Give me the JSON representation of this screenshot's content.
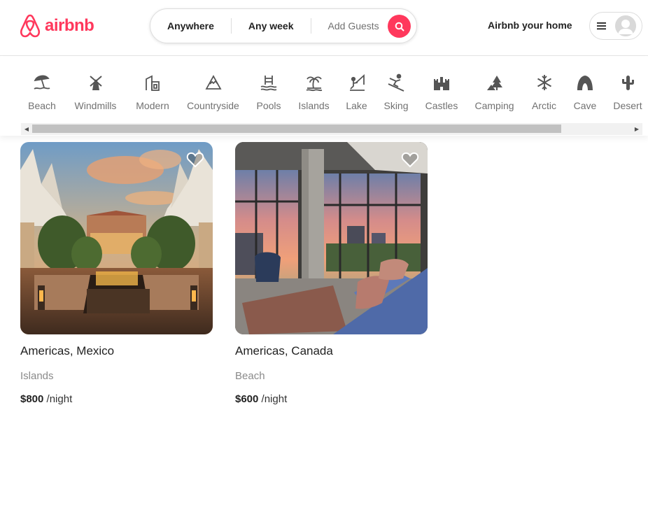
{
  "brand": {
    "name": "airbnb",
    "color": "#ff385c"
  },
  "search": {
    "location": "Anywhere",
    "dates": "Any week",
    "guests": "Add Guests",
    "button_icon": "search-icon"
  },
  "header": {
    "host_link": "Airbnb your home",
    "menu_icon": "hamburger-icon",
    "avatar_icon": "user-avatar-icon"
  },
  "categories": [
    {
      "label": "Beach",
      "icon": "beach-umbrella-icon"
    },
    {
      "label": "Windmills",
      "icon": "windmill-icon"
    },
    {
      "label": "Modern",
      "icon": "modern-house-icon"
    },
    {
      "label": "Countryside",
      "icon": "mountain-icon"
    },
    {
      "label": "Pools",
      "icon": "pool-ladder-icon"
    },
    {
      "label": "Islands",
      "icon": "island-palm-icon"
    },
    {
      "label": "Lake",
      "icon": "fishing-icon"
    },
    {
      "label": "Sking",
      "icon": "skier-icon"
    },
    {
      "label": "Castles",
      "icon": "castle-icon"
    },
    {
      "label": "Camping",
      "icon": "tent-tree-icon"
    },
    {
      "label": "Arctic",
      "icon": "snowflake-icon"
    },
    {
      "label": "Cave",
      "icon": "cave-icon"
    },
    {
      "label": "Desert",
      "icon": "cactus-icon"
    }
  ],
  "listings": [
    {
      "location": "Americas, Mexico",
      "category": "Islands",
      "price": "$800",
      "per": "/night",
      "image": "courtyard-pool-sunset-photo"
    },
    {
      "location": "Americas, Canada",
      "category": "Beach",
      "price": "$600",
      "per": "/night",
      "image": "city-view-living-room-photo"
    }
  ]
}
